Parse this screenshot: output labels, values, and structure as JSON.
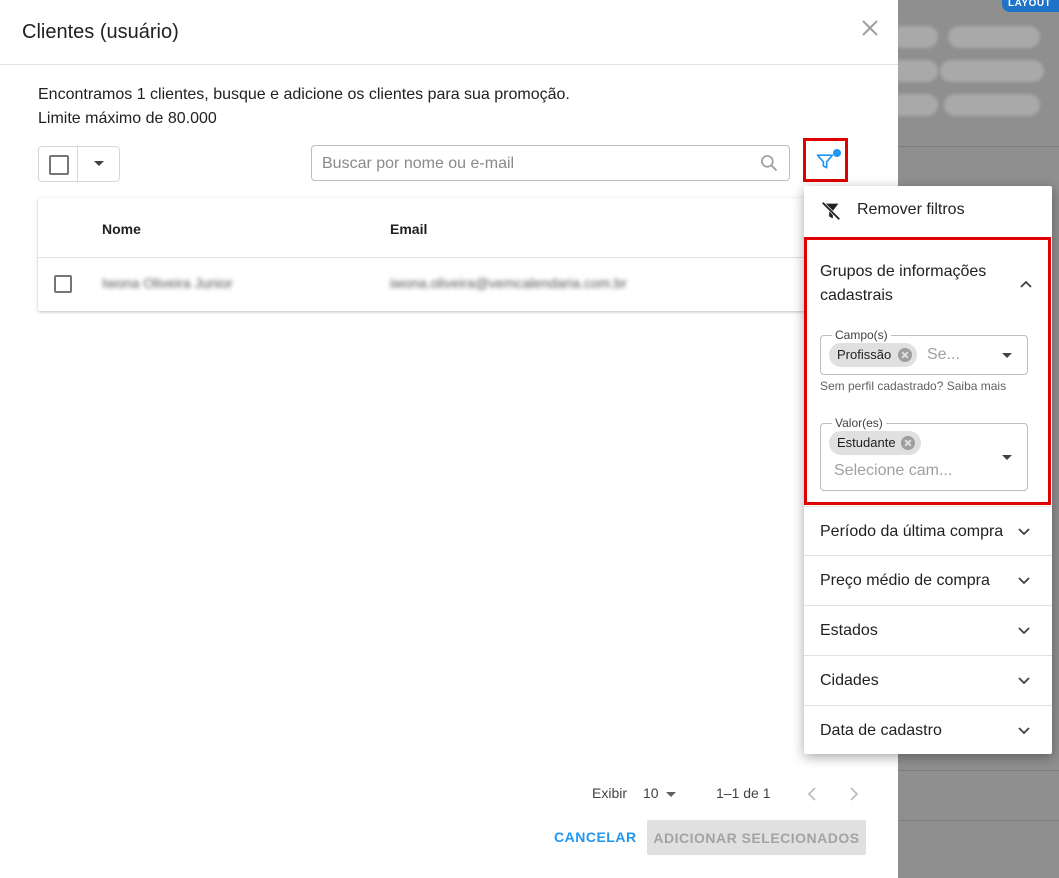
{
  "background": {
    "badge": "LAYOUT"
  },
  "dialog": {
    "title": "Clientes (usuário)",
    "info_line1": "Encontramos 1 clientes, busque e adicione os clientes para sua promoção.",
    "info_line2": "Limite máximo de 80.000",
    "search_placeholder": "Buscar por nome ou e-mail",
    "table": {
      "columns": [
        "Nome",
        "Email"
      ],
      "rows": [
        {
          "name": "Iwona Oliveira Junior",
          "email": "iwona.oliveira@vemcalendaria.com.br"
        }
      ]
    },
    "pagination": {
      "show_label": "Exibir",
      "per_page": "10",
      "range": "1–1 de 1"
    },
    "cancel_label": "CANCELAR",
    "add_label": "ADICIONAR SELECIONADOS"
  },
  "filter_menu": {
    "remove_label": "Remover filtros",
    "group": {
      "title": "Grupos de informações cadastrais",
      "fields_label": "Campo(s)",
      "fields_chip": "Profissão",
      "fields_placeholder": "Se...",
      "helper": "Sem perfil cadastrado? Saiba mais",
      "values_label": "Valor(es)",
      "values_chip": "Estudante",
      "values_placeholder": "Selecione cam..."
    },
    "sections": [
      "Período da última compra",
      "Preço médio de compra",
      "Estados",
      "Cidades",
      "Data de cadastro"
    ]
  },
  "colors": {
    "accent": "#2196f3",
    "highlight": "#e00000"
  }
}
